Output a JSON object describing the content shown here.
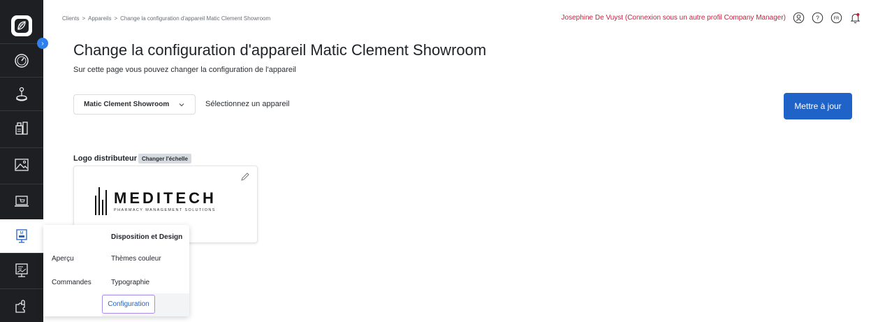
{
  "breadcrumb": {
    "items": [
      "Clients",
      "Appareils",
      "Change la configuration d'appareil Matic Clement Showroom"
    ],
    "separator": ">"
  },
  "header": {
    "user_text": "Josephine De Vuyst (Connexion sous un autre profil Company Manager)",
    "language": "FR",
    "icons": [
      "user-switch-icon",
      "help-icon",
      "language-icon",
      "notification-bell-icon"
    ]
  },
  "page": {
    "title": "Change la configuration d'appareil Matic Clement Showroom",
    "subtitle": "Sur cette page vous pouvez changer la configuration de l'appareil"
  },
  "device_selector": {
    "value": "Matic Clement Showroom",
    "hint": "Sélectionnez un appareil"
  },
  "actions": {
    "update_label": "Mettre à jour"
  },
  "logo_section": {
    "label": "Logo distributeur",
    "scale_badge": "Changer l'échelle",
    "logo_word": "MEDITECH",
    "logo_tagline": "PHARMACY MANAGEMENT SOLUTIONS"
  },
  "sidebar": {
    "items": [
      "dashboard-icon",
      "joystick-icon",
      "products-icon",
      "media-icon",
      "shop-screen-icon",
      "matic-device-icon",
      "presentation-icon",
      "plugins-icon"
    ]
  },
  "flyout": {
    "left_items": [
      "Aperçu",
      "Commandes"
    ],
    "header": "Disposition et Design",
    "right_items": [
      "Thèmes couleur",
      "Typographie",
      "Configuration"
    ]
  },
  "colors": {
    "sidebar_bg": "#1d1f22",
    "accent_blue": "#1f63c9",
    "user_red": "#d01c3c",
    "focus_purple": "#a78be8"
  }
}
